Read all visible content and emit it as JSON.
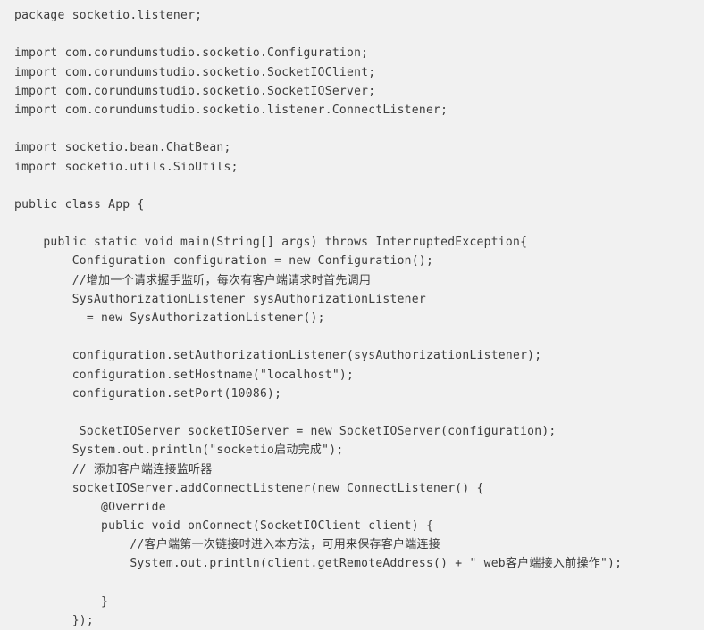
{
  "editor": {
    "language": "java",
    "background_color": "#f1f1f1",
    "text_color": "#3c3c3c",
    "package": "socketio.listener",
    "class_name": "App",
    "lines": [
      "package socketio.listener;",
      "",
      "import com.corundumstudio.socketio.Configuration;",
      "import com.corundumstudio.socketio.SocketIOClient;",
      "import com.corundumstudio.socketio.SocketIOServer;",
      "import com.corundumstudio.socketio.listener.ConnectListener;",
      "",
      "import socketio.bean.ChatBean;",
      "import socketio.utils.SioUtils;",
      "",
      "public class App {",
      "",
      "    public static void main(String[] args) throws InterruptedException{",
      "        Configuration configuration = new Configuration();",
      "        //增加一个请求握手监听，每次有客户端请求时首先调用",
      "        SysAuthorizationListener sysAuthorizationListener",
      "          = new SysAuthorizationListener();",
      "",
      "        configuration.setAuthorizationListener(sysAuthorizationListener);",
      "        configuration.setHostname(\"localhost\");",
      "        configuration.setPort(10086);",
      "",
      "         SocketIOServer socketIOServer = new SocketIOServer(configuration);",
      "        System.out.println(\"socketio启动完成\");",
      "        // 添加客户端连接监听器",
      "        socketIOServer.addConnectListener(new ConnectListener() {",
      "            @Override",
      "            public void onConnect(SocketIOClient client) {",
      "                //客户端第一次链接时进入本方法，可用来保存客户端连接",
      "                System.out.println(client.getRemoteAddress() + \" web客户端接入前操作\");",
      "",
      "            }",
      "        });"
    ]
  }
}
